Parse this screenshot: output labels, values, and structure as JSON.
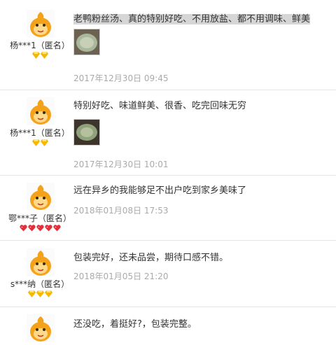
{
  "reviews": [
    {
      "username": "杨***1（匿名）",
      "badge_type": "gold",
      "badge_count": 2,
      "text": "老鸭粉丝汤、真的特别好吃、不用放盐、都不用调味、鲜美",
      "date": "2017年12月30日 09:45",
      "has_image": true,
      "highlight": true
    },
    {
      "username": "杨***1（匿名）",
      "badge_type": "gold",
      "badge_count": 2,
      "text": "特别好吃、味道鲜美、很香、吃完回味无穷",
      "date": "2017年12月30日 10:01",
      "has_image": true,
      "highlight": false
    },
    {
      "username": "鄂***子（匿名）",
      "badge_type": "red",
      "badge_count": 5,
      "text": "远在异乡的我能够足不出户吃到家乡美味了",
      "date": "2018年01月08日 17:53",
      "has_image": false,
      "highlight": false
    },
    {
      "username": "s***纳（匿名）",
      "badge_type": "gold",
      "badge_count": 3,
      "text": "包装完好，还未品尝，期待口感不错。",
      "date": "2018年01月05日 21:20",
      "has_image": false,
      "highlight": false
    },
    {
      "username": "",
      "badge_type": "gold",
      "badge_count": 0,
      "text": "还没吃，着挺好?，包装完整。",
      "date": "",
      "has_image": false,
      "highlight": false
    }
  ],
  "colors": {
    "avatar_orange": "#f5a21b",
    "badge_gold": "#f5b700",
    "badge_red": "#e0303a",
    "date_gray": "#aaaaaa",
    "highlight_gray": "#d6d6d6"
  },
  "icons": {
    "avatar": "orange-mascot-icon",
    "gold_badge": "gold-diamond-icon",
    "red_badge": "red-heart-icon"
  }
}
